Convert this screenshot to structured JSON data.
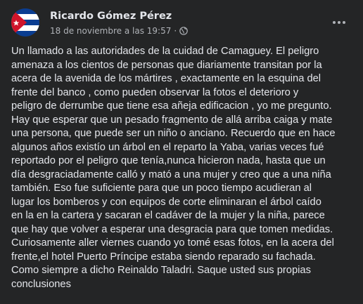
{
  "post": {
    "author_name": "Ricardo Gómez Pérez",
    "timestamp": "18 de noviembre a las 19:57",
    "separator": "·",
    "privacy_icon": "globe-icon",
    "more_icon": "more-horizontal-icon",
    "avatar_icon": "cuban-flag-avatar",
    "body_lines": [
      "Un llamado a las autoridades de la cuidad de Camaguey. El peligro",
      "amenaza a los cientos de personas que diariamente transitan por la",
      "acera de la avenida de los mártires , exactamente en la esquina del",
      "frente del banco , como pueden observar la fotos el deterioro y",
      "peligro de derrumbe que tiene esa añeja edificacion , yo me pregunto.",
      "Hay que esperar que un pesado fragmento de allá arriba caiga y mate",
      "una persona, que puede ser un niño o anciano. Recuerdo que en hace",
      "algunos años existío un árbol en el reparto la Yaba, varias veces fué",
      "reportado por el peligro que tenía,nunca hicieron nada, hasta que un",
      "día desgraciadamente calló y mató a una mujer y creo que a una niña",
      "también. Eso fue suficiente para que un poco tiempo acudieran al",
      "lugar los bomberos y con equipos de corte eliminaran el árbol caído",
      "en la en la cartera  y sacaran el cadáver de la mujer y la niña, parece",
      "que hay que volver a esperar una desgracia para que tomen medidas.",
      "Curiosamente aller viernes cuando yo tomé esas fotos, en la acera del",
      "frente,el hotel Puerto Príncipe estaba siendo reparado su fachada.",
      "Como siempre a dicho Reinaldo Taladri. Saque usted sus propias",
      "conclusiones"
    ]
  },
  "colors": {
    "background": "#242526",
    "primary_text": "#e4e6eb",
    "secondary_text": "#b0b3b8",
    "flag_blue": "#0a3d91",
    "flag_red": "#cf142b",
    "flag_white": "#ffffff"
  }
}
